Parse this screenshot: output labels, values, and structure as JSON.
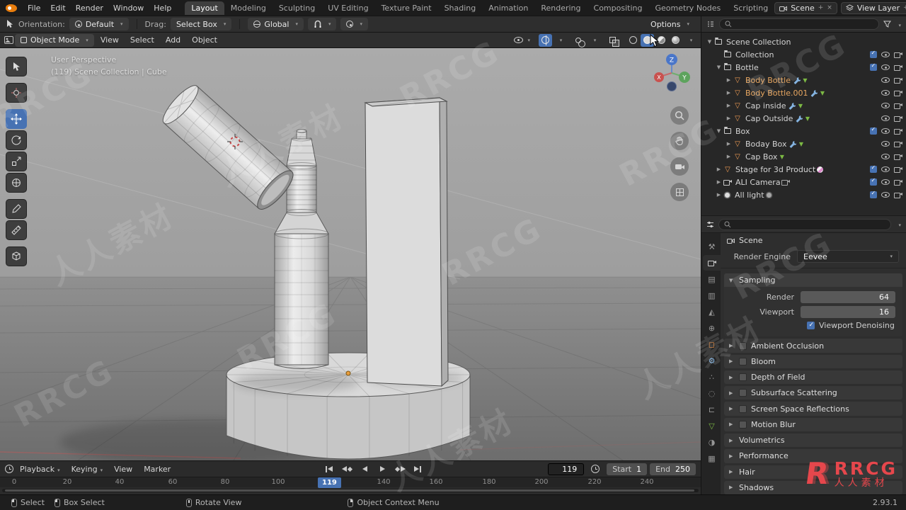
{
  "topbar": {
    "menus": [
      "File",
      "Edit",
      "Render",
      "Window",
      "Help"
    ],
    "workspaces": [
      "Layout",
      "Modeling",
      "Sculpting",
      "UV Editing",
      "Texture Paint",
      "Shading",
      "Animation",
      "Rendering",
      "Compositing",
      "Geometry Nodes",
      "Scripting"
    ],
    "scene_field": "Scene",
    "view_layer_field": "View Layer"
  },
  "tool_settings": {
    "orientation_label": "Orientation:",
    "orientation_value": "Default",
    "drag_label": "Drag:",
    "drag_value": "Select Box",
    "pivot_value": "Global",
    "options_label": "Options"
  },
  "viewport_header": {
    "mode": "Object Mode",
    "menus": [
      "View",
      "Select",
      "Add",
      "Object"
    ]
  },
  "viewport": {
    "overlay_line1": "User Perspective",
    "overlay_line2": "(119) Scene Collection | Cube",
    "axis_z": "Z",
    "axis_y": "Y",
    "axis_x": "X"
  },
  "outliner": {
    "rows": [
      {
        "label": "Scene Collection"
      },
      {
        "label": "Collection"
      },
      {
        "label": "Bottle"
      },
      {
        "label": "Body Bottle"
      },
      {
        "label": "Body Bottle.001"
      },
      {
        "label": "Cap inside"
      },
      {
        "label": "Cap Outside"
      },
      {
        "label": "Box"
      },
      {
        "label": "Boday Box"
      },
      {
        "label": "Cap Box"
      },
      {
        "label": "Stage for 3d Product"
      },
      {
        "label": "ALI Camera"
      },
      {
        "label": "All light"
      }
    ]
  },
  "properties": {
    "breadcrumb": "Scene",
    "render_engine_label": "Render Engine",
    "render_engine_value": "Eevee",
    "sampling": {
      "title": "Sampling",
      "render_label": "Render",
      "render_value": "64",
      "viewport_label": "Viewport",
      "viewport_value": "16",
      "denoising_label": "Viewport Denoising"
    },
    "sections": [
      {
        "label": "Ambient Occlusion"
      },
      {
        "label": "Bloom"
      },
      {
        "label": "Depth of Field"
      },
      {
        "label": "Subsurface Scattering"
      },
      {
        "label": "Screen Space Reflections"
      },
      {
        "label": "Motion Blur"
      },
      {
        "label": "Volumetrics"
      },
      {
        "label": "Performance"
      },
      {
        "label": "Hair"
      },
      {
        "label": "Shadows"
      }
    ]
  },
  "timeline": {
    "menus": [
      "Playback",
      "Keying",
      "View",
      "Marker"
    ],
    "current_frame": "119",
    "playhead_frame": "119",
    "start_label": "Start",
    "start_value": "1",
    "end_label": "End",
    "end_value": "250",
    "ticks": [
      "0",
      "20",
      "40",
      "60",
      "80",
      "100",
      "140",
      "160",
      "180",
      "200",
      "220",
      "240"
    ]
  },
  "statusbar": {
    "select": "Select",
    "box_select": "Box Select",
    "rotate_view": "Rotate View",
    "context_menu": "Object Context Menu",
    "version": "2.93.1"
  },
  "watermark": {
    "brand": "RRCG",
    "brand_cn": "人人素材"
  },
  "colors": {
    "accent_blue": "#4772b3",
    "selected_orange": "#e8a761",
    "logo_red": "#f0484e"
  }
}
